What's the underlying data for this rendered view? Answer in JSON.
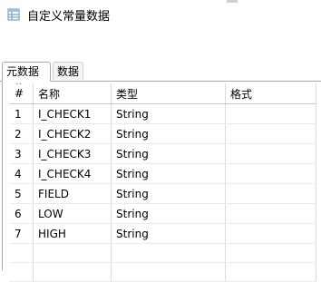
{
  "window": {
    "title": "自定义常量数据",
    "icon": "table-icon"
  },
  "tabs": [
    {
      "label": "元数据",
      "active": true
    },
    {
      "label": "数据",
      "active": false
    }
  ],
  "table": {
    "headers": {
      "index": "#",
      "name": "名称",
      "type": "类型",
      "format": "格式"
    },
    "rows": [
      {
        "index": "1",
        "name": "I_CHECK1",
        "type": "String",
        "format": ""
      },
      {
        "index": "2",
        "name": "I_CHECK2",
        "type": "String",
        "format": ""
      },
      {
        "index": "3",
        "name": "I_CHECK3",
        "type": "String",
        "format": ""
      },
      {
        "index": "4",
        "name": "I_CHECK4",
        "type": "String",
        "format": ""
      },
      {
        "index": "5",
        "name": "FIELD",
        "type": "String",
        "format": ""
      },
      {
        "index": "6",
        "name": "LOW",
        "type": "String",
        "format": ""
      },
      {
        "index": "7",
        "name": "HIGH",
        "type": "String",
        "format": ""
      }
    ]
  }
}
